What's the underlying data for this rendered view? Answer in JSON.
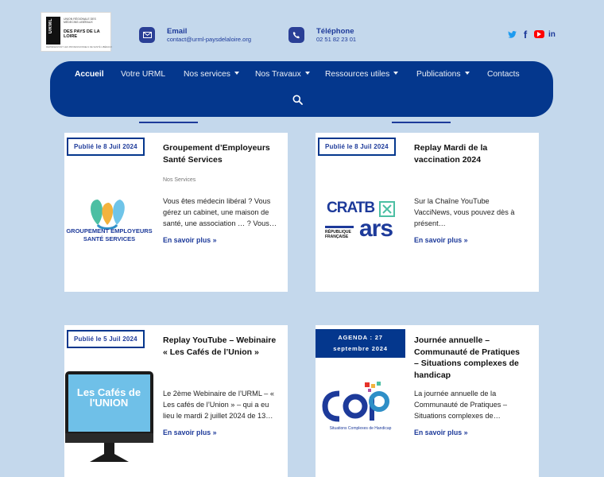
{
  "logo": {
    "mark": "URML",
    "lines": "UNION RÉGIONALE DES MÉDECINS LIBÉRAUX",
    "region": "DES PAYS DE LA LOIRE",
    "tagline": "REPRÉSENTANT LES PROFESSIONNELS DE SANTÉ LIBÉRAUX"
  },
  "contact": {
    "email_title": "Email",
    "email_value": "contact@urml-paysdelaloire.org",
    "phone_title": "Téléphone",
    "phone_value": "02 51 82 23 01"
  },
  "social": [
    "twitter-icon",
    "facebook-icon",
    "youtube-icon",
    "linkedin-icon"
  ],
  "nav": {
    "items": [
      {
        "label": "Accueil"
      },
      {
        "label": "Votre URML"
      },
      {
        "label": "Nos services"
      },
      {
        "label": "Nos Travaux"
      },
      {
        "label": "Ressources utiles"
      },
      {
        "label": "Publications"
      },
      {
        "label": "Contacts"
      }
    ]
  },
  "cards": [
    {
      "badge": "Publié le 8 Juil 2024",
      "title": "Groupement d’Employeurs Santé Services",
      "category": "Nos Services",
      "text": "Vous êtes médecin libéral ? Vous gérez un cabinet, une maison de santé, une association … ? Vous…",
      "more": "En savoir plus »",
      "thumb_text": "GROUPEMENT EMPLOYEURS SANTÉ SERVICES"
    },
    {
      "badge": "Publié le 8 Juil 2024",
      "title": "Replay Mardi de la vaccination 2024",
      "text": "Sur la Chaîne YouTube VacciNews, vous pouvez dès à présent…",
      "more": "En savoir plus »",
      "thumb_text": "CRATB",
      "thumb_text2": "RÉPUBLIQUE FRANÇAISE",
      "thumb_text3": "ars"
    },
    {
      "badge": "Publié le 5 Juil 2024",
      "title": "Replay YouTube – Webinaire « Les Cafés de l’Union »",
      "text": "Le 2ème Webinaire de l’URML – « Les cafés de l’Union » – qui a eu lieu le mardi 2 juillet 2024 de 13…",
      "more": "En savoir plus »",
      "thumb_text": "Les Cafés de l'UNION"
    },
    {
      "badge_line1": "AGENDA : 27",
      "badge_line2": "septembre 2024",
      "title": "Journée annuelle – Communauté de Pratiques – Situations complexes de handicap",
      "text": "La journée annuelle de la Communauté de Pratiques – Situations complexes de…",
      "more": "En savoir plus »",
      "thumb_text": "COP",
      "thumb_text2": "Situations Complexes de Handicap"
    }
  ],
  "colors": {
    "background": "#c4d8ec",
    "nav": "#04378d",
    "accent": "#1d3a9a"
  }
}
